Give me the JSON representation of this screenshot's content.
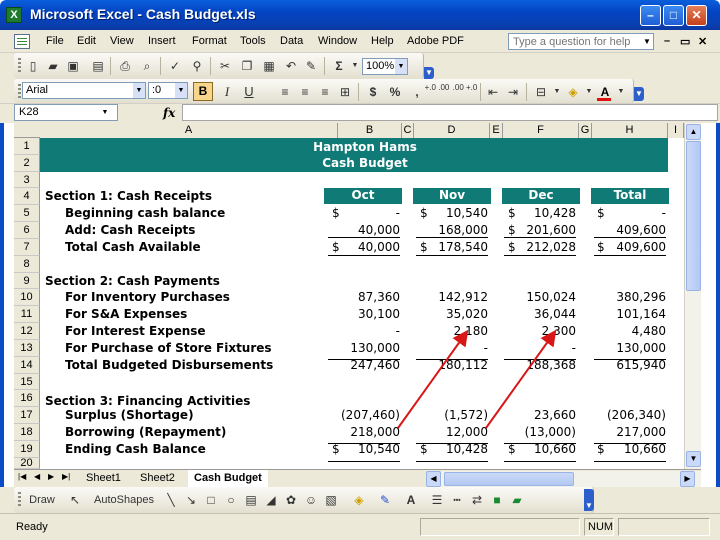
{
  "window": {
    "title": "Microsoft Excel - Cash Budget.xls",
    "app_icon_glyph": "X"
  },
  "menus": [
    "File",
    "Edit",
    "View",
    "Insert",
    "Format",
    "Tools",
    "Data",
    "Window",
    "Help",
    "Adobe PDF"
  ],
  "help": {
    "placeholder": "Type a question for help"
  },
  "standard_toolbar": {
    "zoom": "100%",
    "sigma": "Σ"
  },
  "formatting_toolbar": {
    "font": "Arial",
    "size": ":0",
    "bold": "B",
    "italic": "I",
    "underline": "U",
    "currency": "$",
    "percent": "%",
    "comma": ",",
    "increase_decimal": "+.0 .00",
    "decrease_decimal": ".00 +.0"
  },
  "formula_bar": {
    "name_box": "K28",
    "fx": "fx",
    "content": ""
  },
  "columns": [
    "A",
    "B",
    "C",
    "D",
    "E",
    "F",
    "G",
    "H",
    "I"
  ],
  "rows": [
    "1",
    "2",
    "3",
    "4",
    "5",
    "6",
    "7",
    "8",
    "9",
    "10",
    "11",
    "12",
    "13",
    "14",
    "15",
    "16",
    "17",
    "18",
    "19",
    "20"
  ],
  "sheet": {
    "title": "Hampton Hams",
    "subtitle": "Cash Budget",
    "month_headers": [
      "Oct",
      "Nov",
      "Dec",
      "Total"
    ],
    "section1": "Section 1: Cash Receipts",
    "section2": "Section 2: Cash Payments",
    "section3": "Section 3: Financing Activities",
    "lines": [
      {
        "label": "Beginning cash balance",
        "cur": [
          "$",
          "$",
          "$",
          "$"
        ],
        "vals": [
          "-",
          "10,540",
          "10,428",
          "-"
        ]
      },
      {
        "label": "Add: Cash Receipts",
        "cur": [
          "",
          "",
          "$",
          ""
        ],
        "vals": [
          "40,000",
          "168,000",
          "201,600",
          "409,600"
        ]
      },
      {
        "label": "Total Cash Available",
        "cur": [
          "$",
          "$",
          "$",
          "$"
        ],
        "vals": [
          "40,000",
          "178,540",
          "212,028",
          "409,600"
        ]
      },
      {
        "label": "For Inventory Purchases",
        "cur": [
          "",
          "",
          "",
          ""
        ],
        "vals": [
          "87,360",
          "142,912",
          "150,024",
          "380,296"
        ]
      },
      {
        "label": "For S&A Expenses",
        "cur": [
          "",
          "",
          "",
          ""
        ],
        "vals": [
          "30,100",
          "35,020",
          "36,044",
          "101,164"
        ]
      },
      {
        "label": "For Interest Expense",
        "cur": [
          "",
          "",
          "",
          ""
        ],
        "vals": [
          "-",
          "2,180",
          "2,300",
          "4,480"
        ]
      },
      {
        "label": "For Purchase of Store Fixtures",
        "cur": [
          "",
          "",
          "",
          ""
        ],
        "vals": [
          "130,000",
          "-",
          "-",
          "130,000"
        ]
      },
      {
        "label": "Total Budgeted Disbursements",
        "cur": [
          "",
          "",
          "",
          ""
        ],
        "vals": [
          "247,460",
          "180,112",
          "188,368",
          "615,940"
        ]
      },
      {
        "label": "Surplus (Shortage)",
        "cur": [
          "",
          "",
          "",
          ""
        ],
        "vals": [
          "(207,460)",
          "(1,572)",
          "23,660",
          "(206,340)"
        ]
      },
      {
        "label": "Borrowing (Repayment)",
        "cur": [
          "",
          "",
          "",
          ""
        ],
        "vals": [
          "218,000",
          "12,000",
          "(13,000)",
          "217,000"
        ]
      },
      {
        "label": "Ending Cash Balance",
        "cur": [
          "$",
          "$",
          "$",
          "$"
        ],
        "vals": [
          "10,540",
          "10,428",
          "10,660",
          "10,660"
        ]
      }
    ]
  },
  "tabs": [
    "Sheet1",
    "Sheet2",
    "Cash Budget"
  ],
  "draw_toolbar": {
    "draw": "Draw",
    "autoshapes": "AutoShapes"
  },
  "status": {
    "text": "Ready",
    "num": "NUM"
  },
  "annotation_color": "#d81818",
  "header_color": "#0f7a76"
}
